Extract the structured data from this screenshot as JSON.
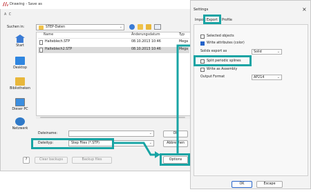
{
  "save_dialog": {
    "title": "Drawing - Save as",
    "lang_letters": "A  C",
    "look_in_label": "Suchen in:",
    "look_in_value": "STEP-Daten",
    "places": [
      {
        "label": "Start",
        "icon": "star-icon"
      },
      {
        "label": "Desktop",
        "icon": "desktop-icon"
      },
      {
        "label": "Bibliotheken",
        "icon": "library-icon"
      },
      {
        "label": "Dieser PC",
        "icon": "computer-icon"
      },
      {
        "label": "Netzwerk",
        "icon": "network-icon"
      }
    ],
    "columns": {
      "name": "Name",
      "date": "Änderungsdatum",
      "type": "Typ"
    },
    "files": [
      {
        "name": "Halteblech.STP",
        "date": "08.10.2013 10:46",
        "type": "Mega",
        "selected": false
      },
      {
        "name": "Halteblech2.STP",
        "date": "08.10.2013 10:46",
        "type": "Mega",
        "selected": true
      }
    ],
    "filename_label": "Dateiname:",
    "filename_value": "",
    "filetype_label": "Dateityp:",
    "filetype_value": "Step Files (*.STP)",
    "ok_label": "OK",
    "cancel_label": "Abbrechen",
    "help_label": "?",
    "clear_backups_label": "Clear backups",
    "backup_files_label": "Backup files",
    "options_label": "Options"
  },
  "settings_dialog": {
    "title": "Settings",
    "tabs": [
      "Import",
      "Export",
      "Profile"
    ],
    "active_tab": "Export",
    "select_objects_label": "Selected objects",
    "write_attributes_label": "Write attributes (color)",
    "solids_label": "Solids export as",
    "solids_value": "Solid",
    "split_periodic_label": "Split periodic splines",
    "write_assembly_label": "Write as Assembly",
    "output_format_label": "Output Format",
    "output_format_value": "AP214",
    "ok_label": "OK",
    "escape_label": "Escape"
  },
  "colors": {
    "highlight": "#18a4a4",
    "accent": "#2563c9"
  }
}
